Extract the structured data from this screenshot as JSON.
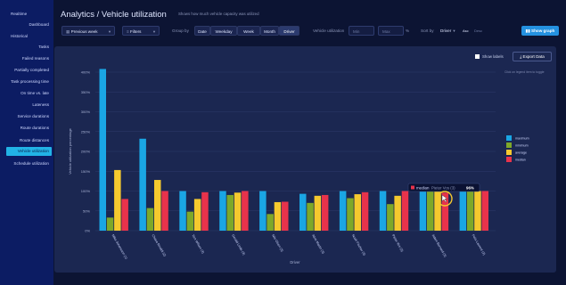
{
  "sidebar": {
    "items": [
      {
        "label": "Realtime",
        "align": "left",
        "top": 13
      },
      {
        "label": "Dashboard",
        "align": "right",
        "top": 25
      },
      {
        "label": "Historical",
        "align": "left",
        "top": 38
      },
      {
        "label": "Tasks",
        "align": "right",
        "top": 50
      },
      {
        "label": "Failed reasons",
        "align": "right",
        "top": 63
      },
      {
        "label": "Partially completed",
        "align": "right",
        "top": 76
      },
      {
        "label": "Task processing time",
        "align": "right",
        "top": 89
      },
      {
        "label": "On time vs. late",
        "align": "right",
        "top": 102
      },
      {
        "label": "Lateness",
        "align": "right",
        "top": 115
      },
      {
        "label": "Service durations",
        "align": "right",
        "top": 128
      },
      {
        "label": "Route durations",
        "align": "right",
        "top": 141
      },
      {
        "label": "Route distances",
        "align": "right",
        "top": 155
      },
      {
        "label": "Vehicle utilization",
        "align": "active",
        "top": 165
      },
      {
        "label": "Schedule utilization",
        "align": "right",
        "top": 181
      }
    ]
  },
  "header": {
    "title": "Analytics / Vehicle utilization",
    "subtitle": "Shows how much vehicle capacity was utilized"
  },
  "controls": {
    "period": "Previous week",
    "filters": "Filters",
    "group_by_label": "Group by",
    "group_options": [
      "Date",
      "Weekday",
      "Week",
      "Month",
      "Driver"
    ],
    "group_selected": "Driver",
    "vu_label": "Vehicle utilization",
    "min_placeholder": "Min",
    "max_placeholder": "Max",
    "percent": "%",
    "sort_label": "Sort by",
    "sort_value": "Driver",
    "asc": "Asc",
    "desc": "Desc",
    "show_graph": "Show graph"
  },
  "panel": {
    "show_labels": "Show labels",
    "export": "Export Data",
    "hint": "Click on legend item to toggle"
  },
  "colors": {
    "maximum": "#1aa6e4",
    "minimum": "#7ea829",
    "average": "#f5c92e",
    "median": "#e8334b",
    "sidebar": "#0c1c63",
    "accent": "#22b3e6"
  },
  "chart_data": {
    "type": "bar",
    "ylabel": "Vehicle utilization percentage",
    "xlabel": "Driver",
    "ylim": [
      0,
      400
    ],
    "yticks": [
      "0%",
      "50%",
      "100%",
      "150%",
      "200%",
      "250%",
      "300%",
      "350%",
      "400%"
    ],
    "categories": [
      "Mika Johansson (1)",
      "Chiara Rinaldi (2)",
      "Tom Wilson (3)",
      "Gerald Linde (3)",
      "Nils Olsen (3)",
      "Aline Martin (3)",
      "Noah Fischer (3)",
      "Pieter Vos (3)",
      "Adam Bernard (3)",
      "Felix Laurent (3)"
    ],
    "series": [
      {
        "name": "maximum",
        "color": "#1aa6e4",
        "values": [
          408,
          232,
          100,
          100,
          100,
          93,
          100,
          100,
          100,
          100
        ]
      },
      {
        "name": "minimum",
        "color": "#7ea829",
        "values": [
          33,
          57,
          48,
          90,
          42,
          70,
          82,
          67,
          100,
          100
        ]
      },
      {
        "name": "average",
        "color": "#f5c92e",
        "values": [
          153,
          128,
          80,
          96,
          72,
          88,
          92,
          88,
          100,
          100
        ]
      },
      {
        "name": "median",
        "color": "#e8334b",
        "values": [
          80,
          100,
          97,
          100,
          73,
          90,
          97,
          100,
          96,
          100
        ]
      }
    ],
    "legend_position": "right",
    "grid": true,
    "tooltip": {
      "series": "median",
      "driver": "Pieter Vos (3)",
      "value": "96%"
    }
  }
}
